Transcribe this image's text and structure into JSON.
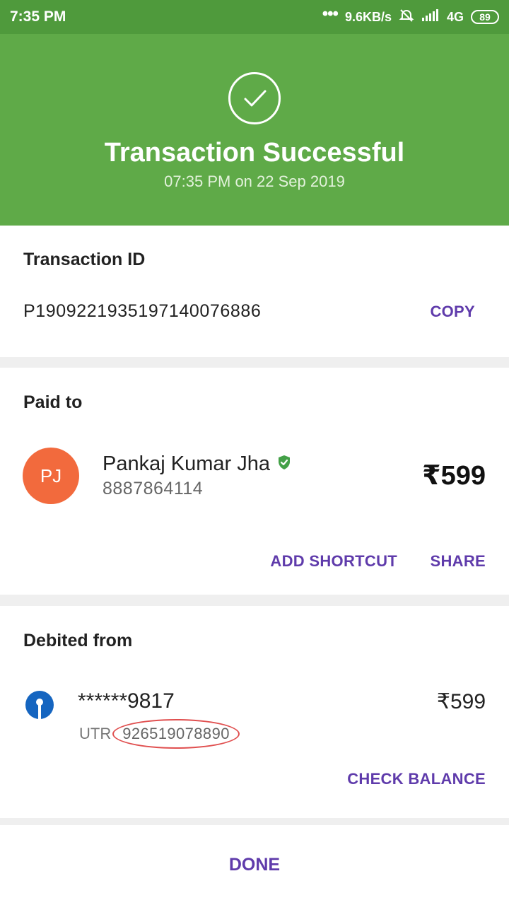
{
  "status_bar": {
    "time": "7:35 PM",
    "dots": "•••",
    "speed": "9.6KB/s",
    "network": "4G",
    "battery": "89"
  },
  "header": {
    "title": "Transaction Successful",
    "date": "07:35 PM on 22 Sep 2019"
  },
  "transaction": {
    "label": "Transaction ID",
    "id": "P1909221935197140076886",
    "copy_label": "COPY"
  },
  "paid_to": {
    "label": "Paid to",
    "initials": "PJ",
    "name": "Pankaj Kumar Jha",
    "phone": "8887864114",
    "amount": "₹599",
    "add_shortcut_label": "ADD SHORTCUT",
    "share_label": "SHARE"
  },
  "debited_from": {
    "label": "Debited from",
    "account": "******9817",
    "utr_label": "UTR",
    "utr_value": "926519078890",
    "amount": "₹599",
    "check_balance_label": "CHECK BALANCE"
  },
  "footer": {
    "done_label": "DONE"
  },
  "colors": {
    "header_green": "#5faa48",
    "status_green": "#4f9a3c",
    "accent_purple": "#5f3bab",
    "avatar_orange": "#f26a3d",
    "verified_green": "#43a047",
    "bank_blue": "#1565c0"
  }
}
